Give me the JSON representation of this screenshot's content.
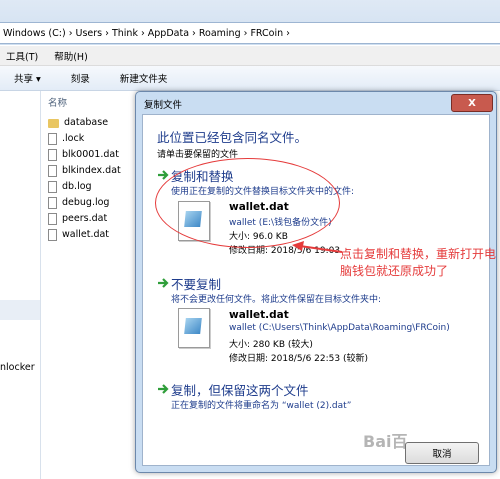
{
  "explorer": {
    "breadcrumb": "Windows (C:) › Users › Think › AppData › Roaming › FRCoin ›",
    "menu": {
      "tools": "工具(T)",
      "help": "帮助(H)"
    },
    "toolbar": {
      "share": "共享 ▾",
      "burn": "刻录",
      "new_folder": "新建文件夹"
    },
    "nav_partial_label": "nlocker",
    "column_name": "名称",
    "files": [
      {
        "name": "database",
        "kind": "folder"
      },
      {
        "name": ".lock",
        "kind": "file"
      },
      {
        "name": "blk0001.dat",
        "kind": "file"
      },
      {
        "name": "blkindex.dat",
        "kind": "file"
      },
      {
        "name": "db.log",
        "kind": "file"
      },
      {
        "name": "debug.log",
        "kind": "file"
      },
      {
        "name": "peers.dat",
        "kind": "file"
      },
      {
        "name": "wallet.dat",
        "kind": "file"
      }
    ]
  },
  "dialog": {
    "title": "复制文件",
    "close": "X",
    "heading": "此位置已经包含同名文件。",
    "subheading": "请单击要保留的文件",
    "option_replace": {
      "title": "复制和替换",
      "desc": "使用正在复制的文件替换目标文件夹中的文件:",
      "file_name": "wallet.dat",
      "file_path": "wallet (E:\\钱包备份文件)",
      "size": "大小: 96.0 KB",
      "modified": "修改日期: 2018/5/6 19:03"
    },
    "option_skip": {
      "title": "不要复制",
      "desc": "将不会更改任何文件。将此文件保留在目标文件夹中:",
      "file_name": "wallet.dat",
      "file_path": "wallet (C:\\Users\\Think\\AppData\\Roaming\\FRCoin)",
      "size": "大小: 280 KB (较大)",
      "modified": "修改日期: 2018/5/6 22:53 (较新)"
    },
    "option_keep_both": {
      "title": "复制，但保留这两个文件",
      "desc": "正在复制的文件将重命名为 “wallet (2).dat”"
    },
    "cancel": "取消"
  },
  "annotation": {
    "text": "点击复制和替换，重新打开电脑钱包就还原成功了",
    "color": "#e53b3b"
  },
  "watermark": "Bai百"
}
